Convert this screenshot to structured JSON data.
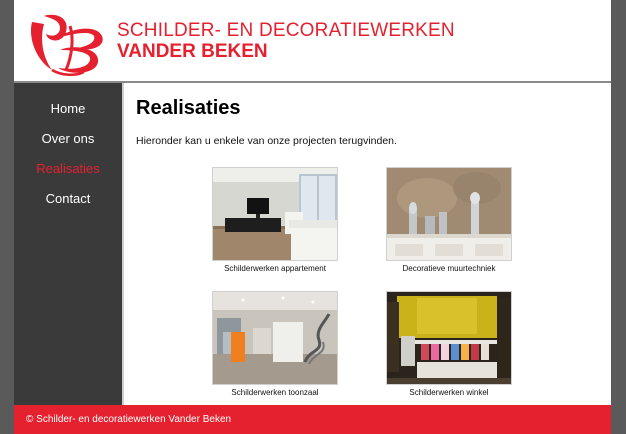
{
  "header": {
    "brand_line1": "SCHILDER- EN DECORATIEWERKEN",
    "brand_line2": "VANDER BEKEN",
    "logo_icon": "vb-monogram-logo"
  },
  "nav": {
    "items": [
      {
        "label": "Home",
        "active": false
      },
      {
        "label": "Over ons",
        "active": false
      },
      {
        "label": "Realisaties",
        "active": true
      },
      {
        "label": "Contact",
        "active": false
      }
    ]
  },
  "main": {
    "title": "Realisaties",
    "intro": "Hieronder kan u enkele van onze projecten terugvinden.",
    "projects": [
      {
        "caption": "Schilderwerken appartement"
      },
      {
        "caption": "Decoratieve muurtechniek"
      },
      {
        "caption": "Schilderwerken toonzaal"
      },
      {
        "caption": "Schilderwerken winkel"
      }
    ]
  },
  "footer": {
    "text": "© Schilder- en decoratiewerken Vander Beken"
  },
  "colors": {
    "brand_red": "#e5202f",
    "sidebar": "#3a3a3a",
    "outer_bg": "#5a5a5a"
  }
}
